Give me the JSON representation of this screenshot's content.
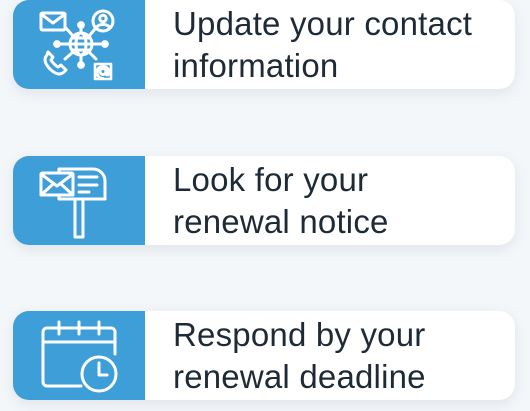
{
  "steps": [
    {
      "icon": "contact-network-icon",
      "line1": "Update your contact",
      "line2": "information"
    },
    {
      "icon": "mailbox-icon",
      "line1": "Look for your",
      "line2": "renewal notice"
    },
    {
      "icon": "calendar-clock-icon",
      "line1": "Respond by your",
      "line2": "renewal deadline"
    }
  ],
  "colors": {
    "tile": "#3e9ed8",
    "text": "#1f2a37",
    "background": "#f4f7fa",
    "card": "#ffffff"
  }
}
